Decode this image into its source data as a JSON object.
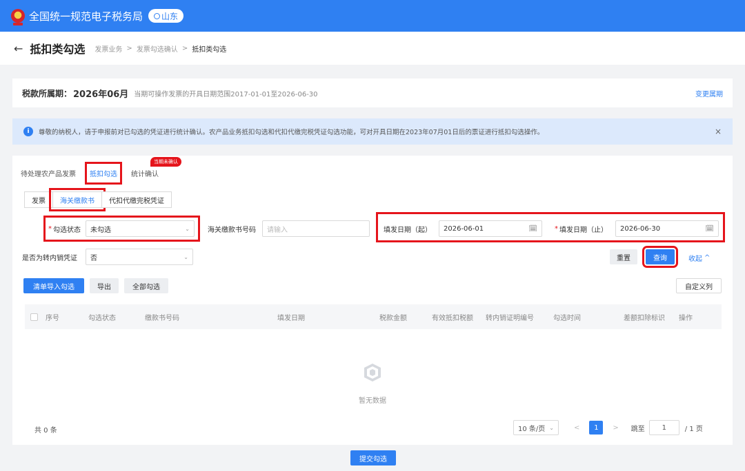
{
  "topbar": {
    "title": "全国统一规范电子税务局",
    "region": "山东",
    "logo_icon": "tax-emblem-icon"
  },
  "header": {
    "back_icon": "←",
    "title": "抵扣类勾选",
    "breadcrumb": [
      "发票业务",
      "发票勾选确认",
      "抵扣类勾选"
    ],
    "separator": ">"
  },
  "period": {
    "label": "税款所属期：",
    "value": "2026年06月",
    "note": "当期可操作发票的开具日期范围2017-01-01至2026-06-30",
    "change_link": "变更属期"
  },
  "alert": {
    "icon": "i",
    "text": "尊敬的纳税人，请于申报前对已勾选的凭证进行统计确认。农产品业务抵扣勾选和代扣代缴完税凭证勾选功能，可对开具日期在2023年07月01日后的票证进行抵扣勾选操作。",
    "close": "×"
  },
  "main_tabs": [
    {
      "label": "待处理农产品发票"
    },
    {
      "label": "抵扣勾选"
    },
    {
      "label": "统计确认",
      "badge": "当期未确认"
    }
  ],
  "sub_tabs": [
    {
      "label": "发票"
    },
    {
      "label": "海关缴款书"
    },
    {
      "label": "代扣代缴完税凭证"
    }
  ],
  "filters": {
    "status_label": "勾选状态",
    "status_value": "未勾选",
    "bill_no_label": "海关缴款书号码",
    "bill_no_placeholder": "请输入",
    "date_start_label": "填发日期（起）",
    "date_start_value": "2026-06-01",
    "date_end_label": "填发日期（止）",
    "date_end_value": "2026-06-30",
    "transfer_label": "是否为转内销凭证",
    "transfer_value": "否",
    "required_mark": "*",
    "calendar_icon": "🗓",
    "chevron": "⌄"
  },
  "actions": {
    "reset": "重置",
    "query": "查询",
    "collapse": "收起",
    "collapse_icon": "^",
    "import": "清单导入勾选",
    "export": "导出",
    "select_all": "全部勾选",
    "custom_columns": "自定义列"
  },
  "table": {
    "columns": [
      "序号",
      "勾选状态",
      "缴款书号码",
      "填发日期",
      "税款金额",
      "有效抵扣税额",
      "转内销证明编号",
      "勾选时间",
      "差额扣除标识",
      "操作"
    ],
    "empty_text": "暂无数据"
  },
  "pagination": {
    "total": "共 0 条",
    "page_size": "10 条/页",
    "prev": "<",
    "next": ">",
    "current": "1",
    "jump_label": "跳至",
    "jump_value": "1",
    "total_pages": "/ 1 页"
  },
  "submit": "提交勾选",
  "colors": {
    "primary": "#2f80f2",
    "highlight": "#e5141b",
    "alert_bg": "#dce9fc"
  }
}
